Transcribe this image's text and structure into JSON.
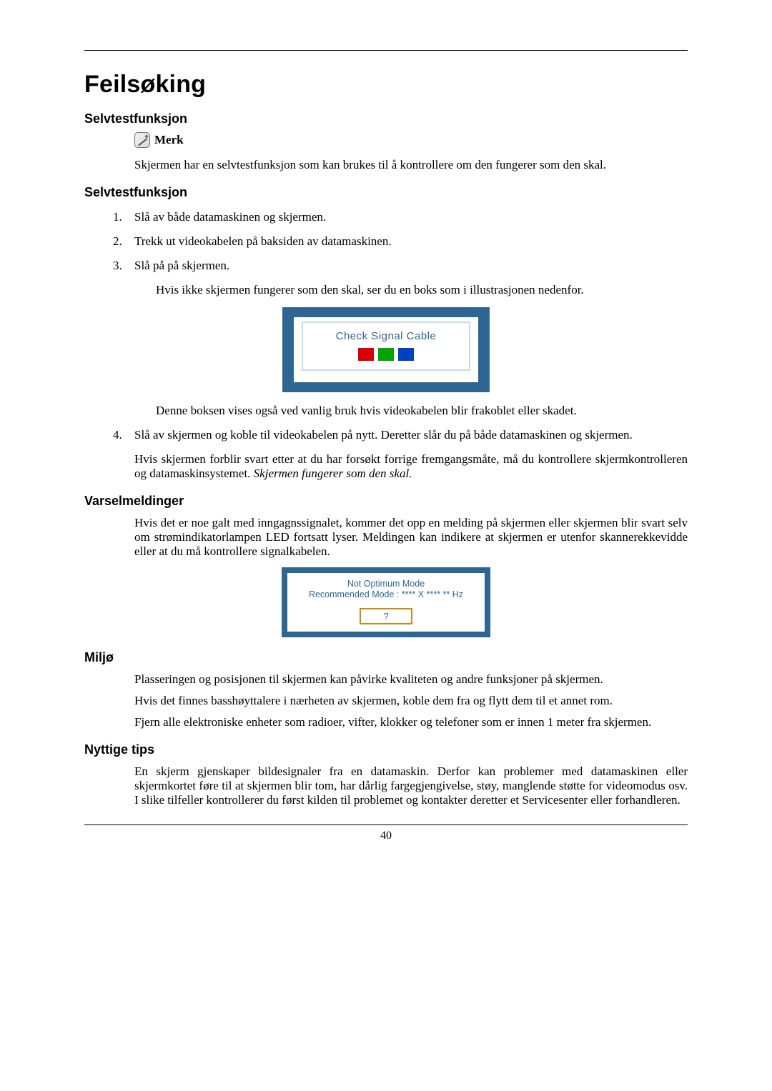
{
  "page_number": "40",
  "title": "Feilsøking",
  "sections": {
    "s1": {
      "heading": "Selvtestfunksjon",
      "note_label": "Merk",
      "intro": "Skjermen har en selvtestfunksjon som kan brukes til å kontrollere om den fungerer som den skal."
    },
    "s2": {
      "heading": "Selvtestfunksjon",
      "steps": [
        "Slå av både datamaskinen og skjermen.",
        "Trekk ut videokabelen på baksiden av datamaskinen.",
        "Slå på på skjermen."
      ],
      "after_step3": "Hvis ikke skjermen fungerer som den skal, ser du en boks som i illustrasjonen nedenfor.",
      "fig1_text": "Check Signal Cable",
      "after_fig1": "Denne boksen vises også ved vanlig bruk hvis videokabelen blir frakoblet eller skadet.",
      "step4": "Slå av skjermen og koble til videokabelen på nytt. Deretter slår du på både datamaskinen og skjermen.",
      "closing_a": "Hvis skjermen forblir svart etter at du har forsøkt forrige fremgangsmåte, må du kontrollere skjermkontrolleren og datamaskinsystemet. ",
      "closing_b": "Skjermen fungerer som den skal."
    },
    "s3": {
      "heading": "Varselmeldinger",
      "para": "Hvis det er noe galt med inngagnssignalet, kommer det opp en melding på skjermen eller skjermen blir svart selv om strømindikatorlampen LED fortsatt lyser. Meldingen kan indikere at skjermen er utenfor skannerekkevidde eller at du må kontrollere signalkabelen.",
      "fig2_line1": "Not Optimum Mode",
      "fig2_line2": "Recommended Mode : **** X **** ** Hz",
      "fig2_btn": "?"
    },
    "s4": {
      "heading": "Miljø",
      "p1": "Plasseringen og posisjonen til skjermen kan påvirke kvaliteten og andre funksjoner på skjermen.",
      "p2": "Hvis det finnes basshøyttalere i nærheten av skjermen, koble dem fra og flytt dem til et annet rom.",
      "p3": "Fjern alle elektroniske enheter som radioer, vifter, klokker og telefoner som er innen 1 meter fra skjermen."
    },
    "s5": {
      "heading": "Nyttige tips",
      "p1": "En skjerm gjenskaper bildesignaler fra en datamaskin. Derfor kan problemer med datamaskinen eller skjermkortet føre til at skjermen blir tom, har dårlig fargegjengivelse, støy, manglende støtte for videomodus osv. I slike tilfeller kontrollerer du først kilden til problemet og kontakter deretter et Servicesenter eller forhandleren."
    }
  }
}
